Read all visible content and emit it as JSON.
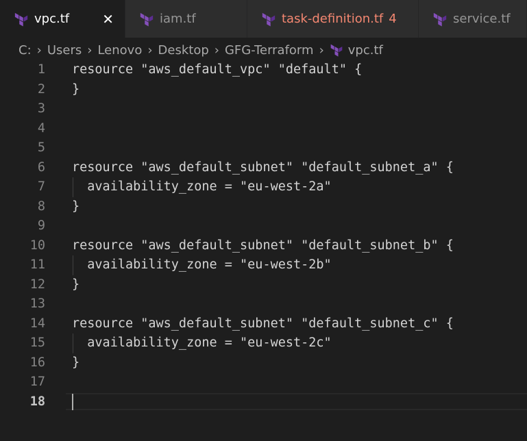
{
  "tabs": [
    {
      "label": "vpc.tf",
      "active": true,
      "close": "✕",
      "icon": "terraform-icon"
    },
    {
      "label": "iam.tf",
      "active": false,
      "icon": "terraform-icon"
    },
    {
      "label": "task-definition.tf",
      "badge": "4",
      "active": false,
      "icon": "terraform-icon"
    },
    {
      "label": "service.tf",
      "active": false,
      "icon": "terraform-icon"
    }
  ],
  "breadcrumb": {
    "parts": [
      "C:",
      "Users",
      "Lenovo",
      "Desktop",
      "GFG-Terraform"
    ],
    "file": "vpc.tf",
    "separator": "›"
  },
  "editor": {
    "current_line": 18,
    "lines": [
      {
        "num": "1",
        "text": "resource \"aws_default_vpc\" \"default\" {"
      },
      {
        "num": "2",
        "text": "}"
      },
      {
        "num": "3",
        "text": ""
      },
      {
        "num": "4",
        "text": ""
      },
      {
        "num": "5",
        "text": ""
      },
      {
        "num": "6",
        "text": "resource \"aws_default_subnet\" \"default_subnet_a\" {"
      },
      {
        "num": "7",
        "text": "  availability_zone = \"eu-west-2a\""
      },
      {
        "num": "8",
        "text": "}"
      },
      {
        "num": "9",
        "text": ""
      },
      {
        "num": "10",
        "text": "resource \"aws_default_subnet\" \"default_subnet_b\" {"
      },
      {
        "num": "11",
        "text": "  availability_zone = \"eu-west-2b\""
      },
      {
        "num": "12",
        "text": "}"
      },
      {
        "num": "13",
        "text": ""
      },
      {
        "num": "14",
        "text": "resource \"aws_default_subnet\" \"default_subnet_c\" {"
      },
      {
        "num": "15",
        "text": "  availability_zone = \"eu-west-2c\""
      },
      {
        "num": "16",
        "text": "}"
      },
      {
        "num": "17",
        "text": ""
      },
      {
        "num": "18",
        "text": ""
      }
    ]
  },
  "colors": {
    "terraform": "#7b42bc",
    "error": "#f48771",
    "background": "#1e1e1e"
  }
}
